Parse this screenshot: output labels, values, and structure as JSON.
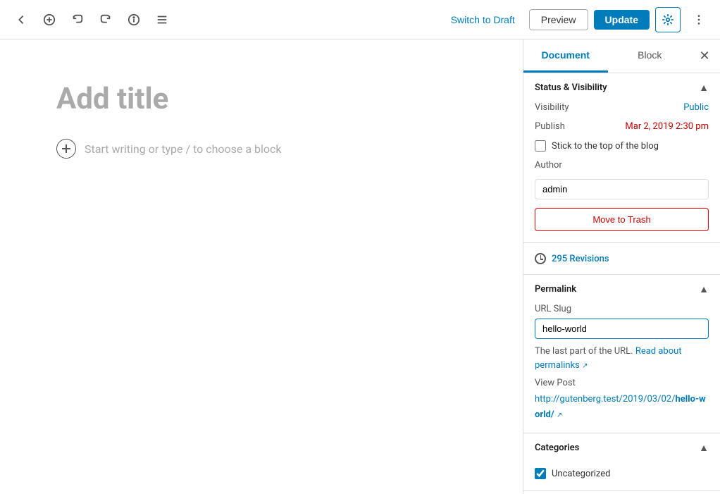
{
  "toolbar": {
    "switch_draft_label": "Switch to Draft",
    "preview_label": "Preview",
    "update_label": "Update"
  },
  "editor": {
    "title_placeholder": "Add title",
    "block_placeholder": "Start writing or type / to choose a block"
  },
  "sidebar": {
    "tab_document": "Document",
    "tab_block": "Block",
    "status_visibility": {
      "section_title": "Status & Visibility",
      "visibility_label": "Visibility",
      "visibility_value": "Public",
      "publish_label": "Publish",
      "publish_value": "Mar 2, 2019 2:30 pm",
      "stick_to_top_label": "Stick to the top of the blog",
      "author_label": "Author",
      "author_value": "admin",
      "move_to_trash_label": "Move to Trash"
    },
    "revisions": {
      "count": "295",
      "label": "Revisions",
      "text": "295 Revisions"
    },
    "permalink": {
      "section_title": "Permalink",
      "url_slug_label": "URL Slug",
      "url_slug_value": "hello-world",
      "note_prefix": "The last part of the URL.",
      "read_about_label": "Read about",
      "permalinks_label": "permalinks",
      "view_post_label": "View Post",
      "view_post_url_prefix": "http://gutenberg.test/2019/03/02/",
      "view_post_url_bold": "hello-world/",
      "view_post_url_suffix": ""
    },
    "categories": {
      "section_title": "Categories",
      "items": [
        {
          "label": "Uncategorized",
          "checked": true
        }
      ]
    }
  }
}
